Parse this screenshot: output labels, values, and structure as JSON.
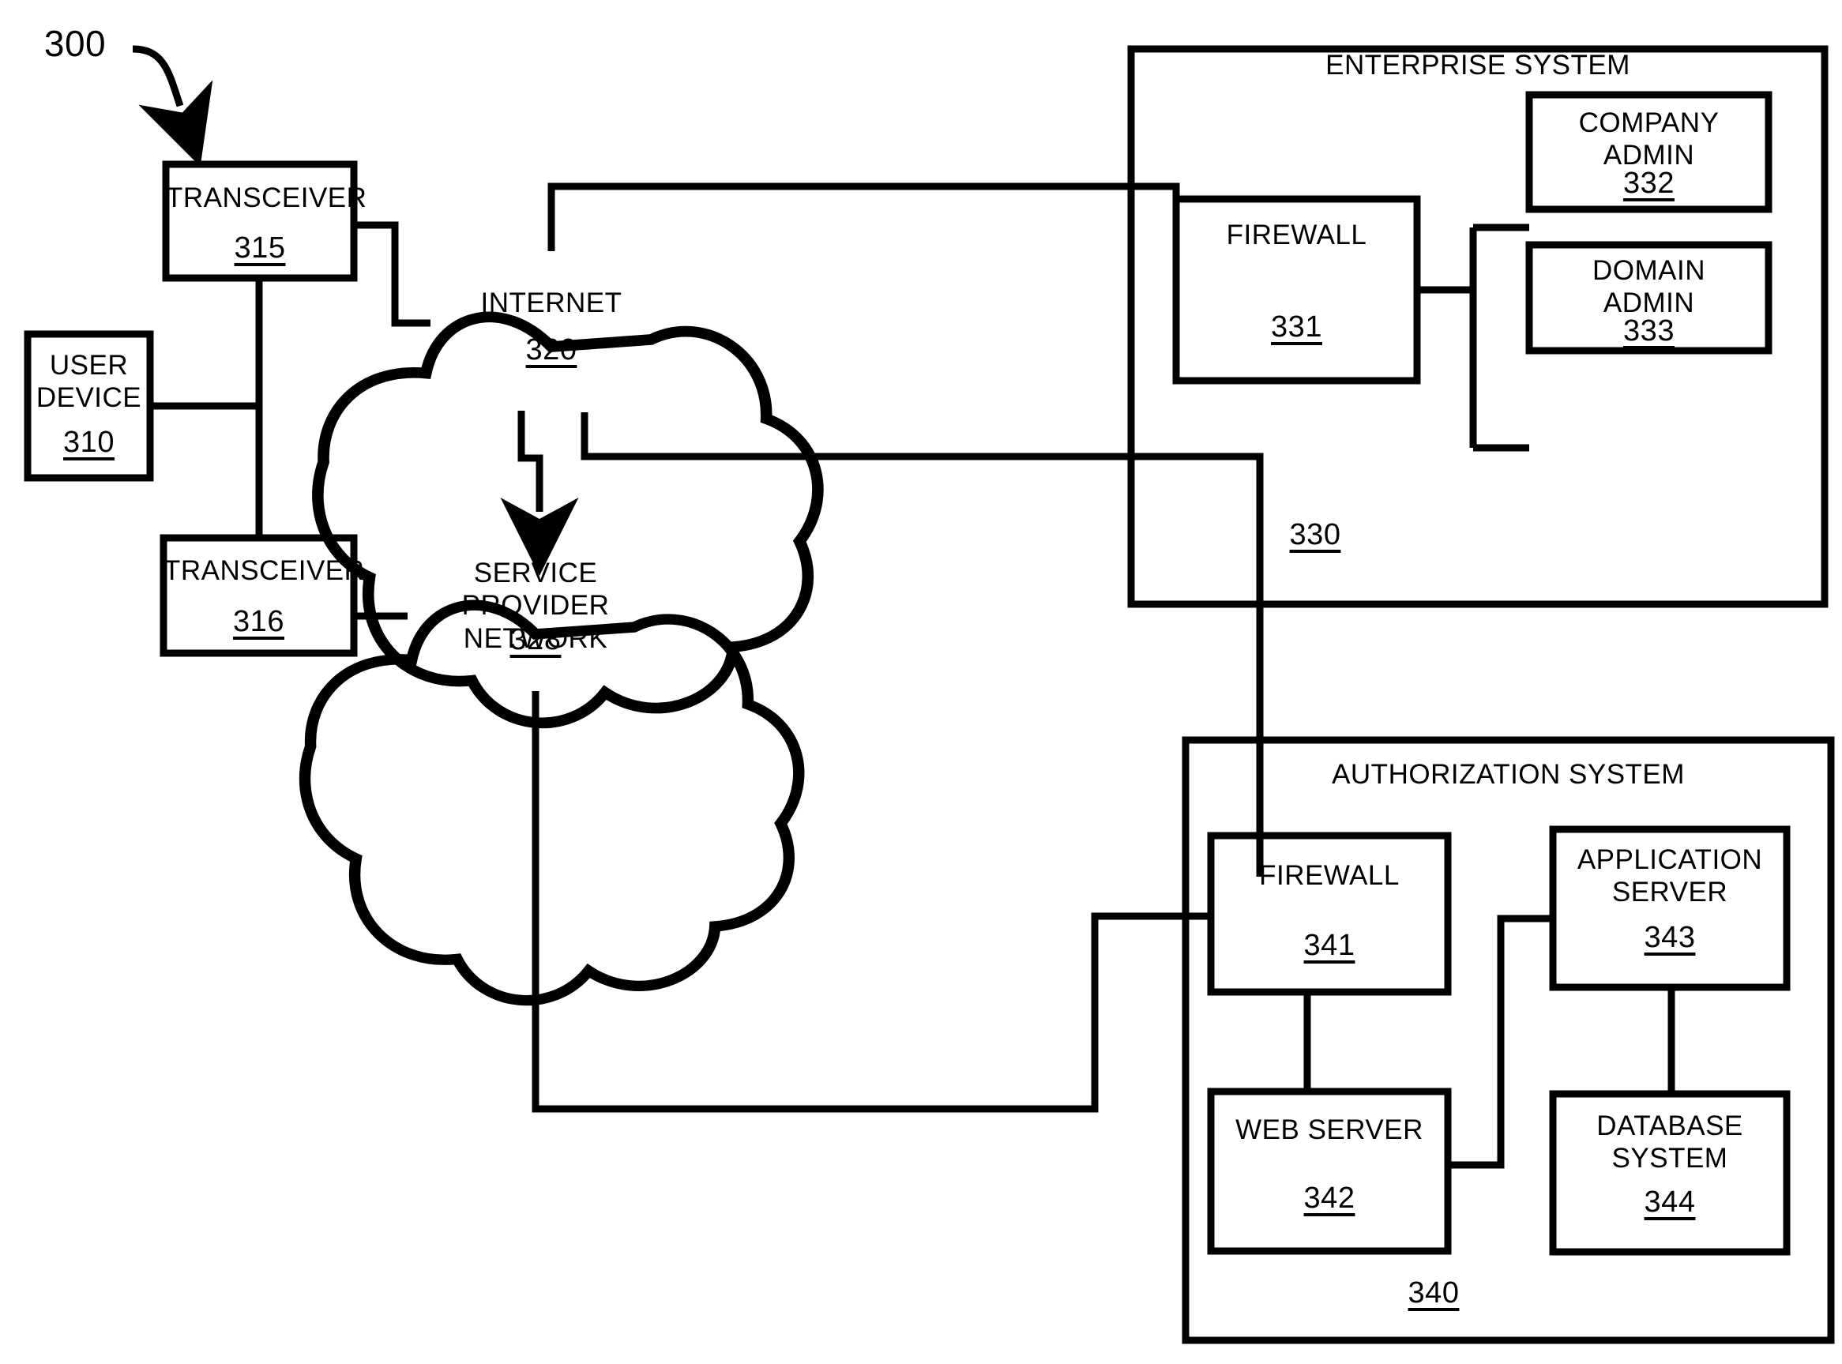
{
  "figure": {
    "number": "300",
    "caption_arrow": "arrow-pointing-to-diagram"
  },
  "nodes": {
    "user_device": {
      "title": "USER\nDEVICE",
      "ref": "310"
    },
    "transceiver_top": {
      "title": "TRANSCEIVER",
      "ref": "315"
    },
    "transceiver_bottom": {
      "title": "TRANSCEIVER",
      "ref": "316"
    },
    "internet": {
      "title": "INTERNET",
      "ref": "320"
    },
    "service_provider_network": {
      "title": "SERVICE PROVIDER\nNETWORK",
      "ref": "328"
    },
    "enterprise_firewall": {
      "title": "FIREWALL",
      "ref": "331"
    },
    "company_admin": {
      "title": "COMPANY\nADMIN",
      "ref": "332"
    },
    "domain_admin": {
      "title": "DOMAIN\nADMIN",
      "ref": "333"
    },
    "auth_firewall": {
      "title": "FIREWALL",
      "ref": "341"
    },
    "web_server": {
      "title": "WEB SERVER",
      "ref": "342"
    },
    "application_server": {
      "title": "APPLICATION\nSERVER",
      "ref": "343"
    },
    "database_system": {
      "title": "DATABASE\nSYSTEM",
      "ref": "344"
    }
  },
  "groups": {
    "enterprise_system": {
      "title": "ENTERPRISE SYSTEM",
      "ref": "330"
    },
    "authorization_system": {
      "title": "AUTHORIZATION SYSTEM",
      "ref": "340"
    }
  },
  "style": {
    "stroke": "#000000",
    "background": "#ffffff"
  }
}
